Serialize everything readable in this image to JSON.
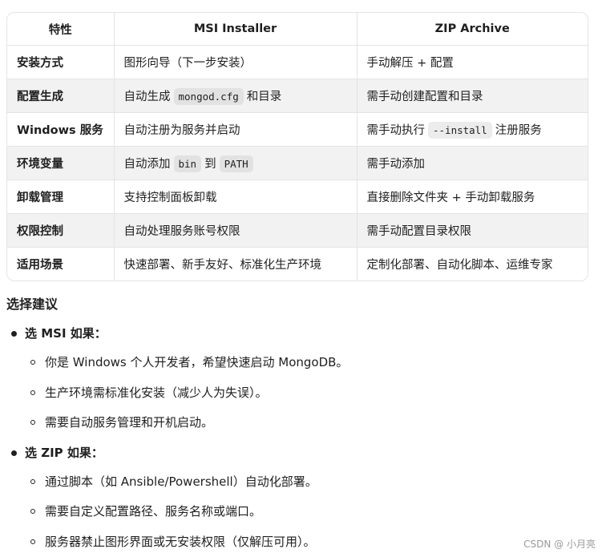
{
  "table": {
    "headers": [
      "特性",
      "MSI Installer",
      "ZIP Archive"
    ],
    "rows": [
      {
        "feature": "安装方式",
        "msi": [
          "图形向导（下一步安装）"
        ],
        "zip": [
          "手动解压 + 配置"
        ]
      },
      {
        "feature": "配置生成",
        "msi": [
          "自动生成",
          "mongod.cfg",
          "和目录"
        ],
        "zip": [
          "需手动创建配置和目录"
        ]
      },
      {
        "feature": "Windows 服务",
        "msi": [
          "自动注册为服务并启动"
        ],
        "zip": [
          "需手动执行",
          "--install",
          "注册服务"
        ]
      },
      {
        "feature": "环境变量",
        "msi": [
          "自动添加",
          "bin",
          "到",
          "PATH"
        ],
        "zip": [
          "需手动添加"
        ]
      },
      {
        "feature": "卸载管理",
        "msi": [
          "支持控制面板卸载"
        ],
        "zip": [
          "直接删除文件夹 + 手动卸载服务"
        ]
      },
      {
        "feature": "权限控制",
        "msi": [
          "自动处理服务账号权限"
        ],
        "zip": [
          "需手动配置目录权限"
        ]
      },
      {
        "feature": "适用场景",
        "msi": [
          "快速部署、新手友好、标准化生产环境"
        ],
        "zip": [
          "定制化部署、自动化脚本、运维专家"
        ]
      }
    ]
  },
  "advice": {
    "title": "选择建议",
    "groups": [
      {
        "heading": "选 MSI 如果：",
        "items": [
          "你是 Windows 个人开发者，希望快速启动 MongoDB。",
          "生产环境需标准化安装（减少人为失误）。",
          "需要自动服务管理和开机启动。"
        ]
      },
      {
        "heading": "选 ZIP 如果：",
        "items": [
          "通过脚本（如 Ansible/Powershell）自动化部署。",
          "需要自定义配置路径、服务名称或端口。",
          "服务器禁止图形界面或无安装权限（仅解压可用）。"
        ]
      }
    ]
  },
  "watermark": "CSDN @ 小月亮"
}
